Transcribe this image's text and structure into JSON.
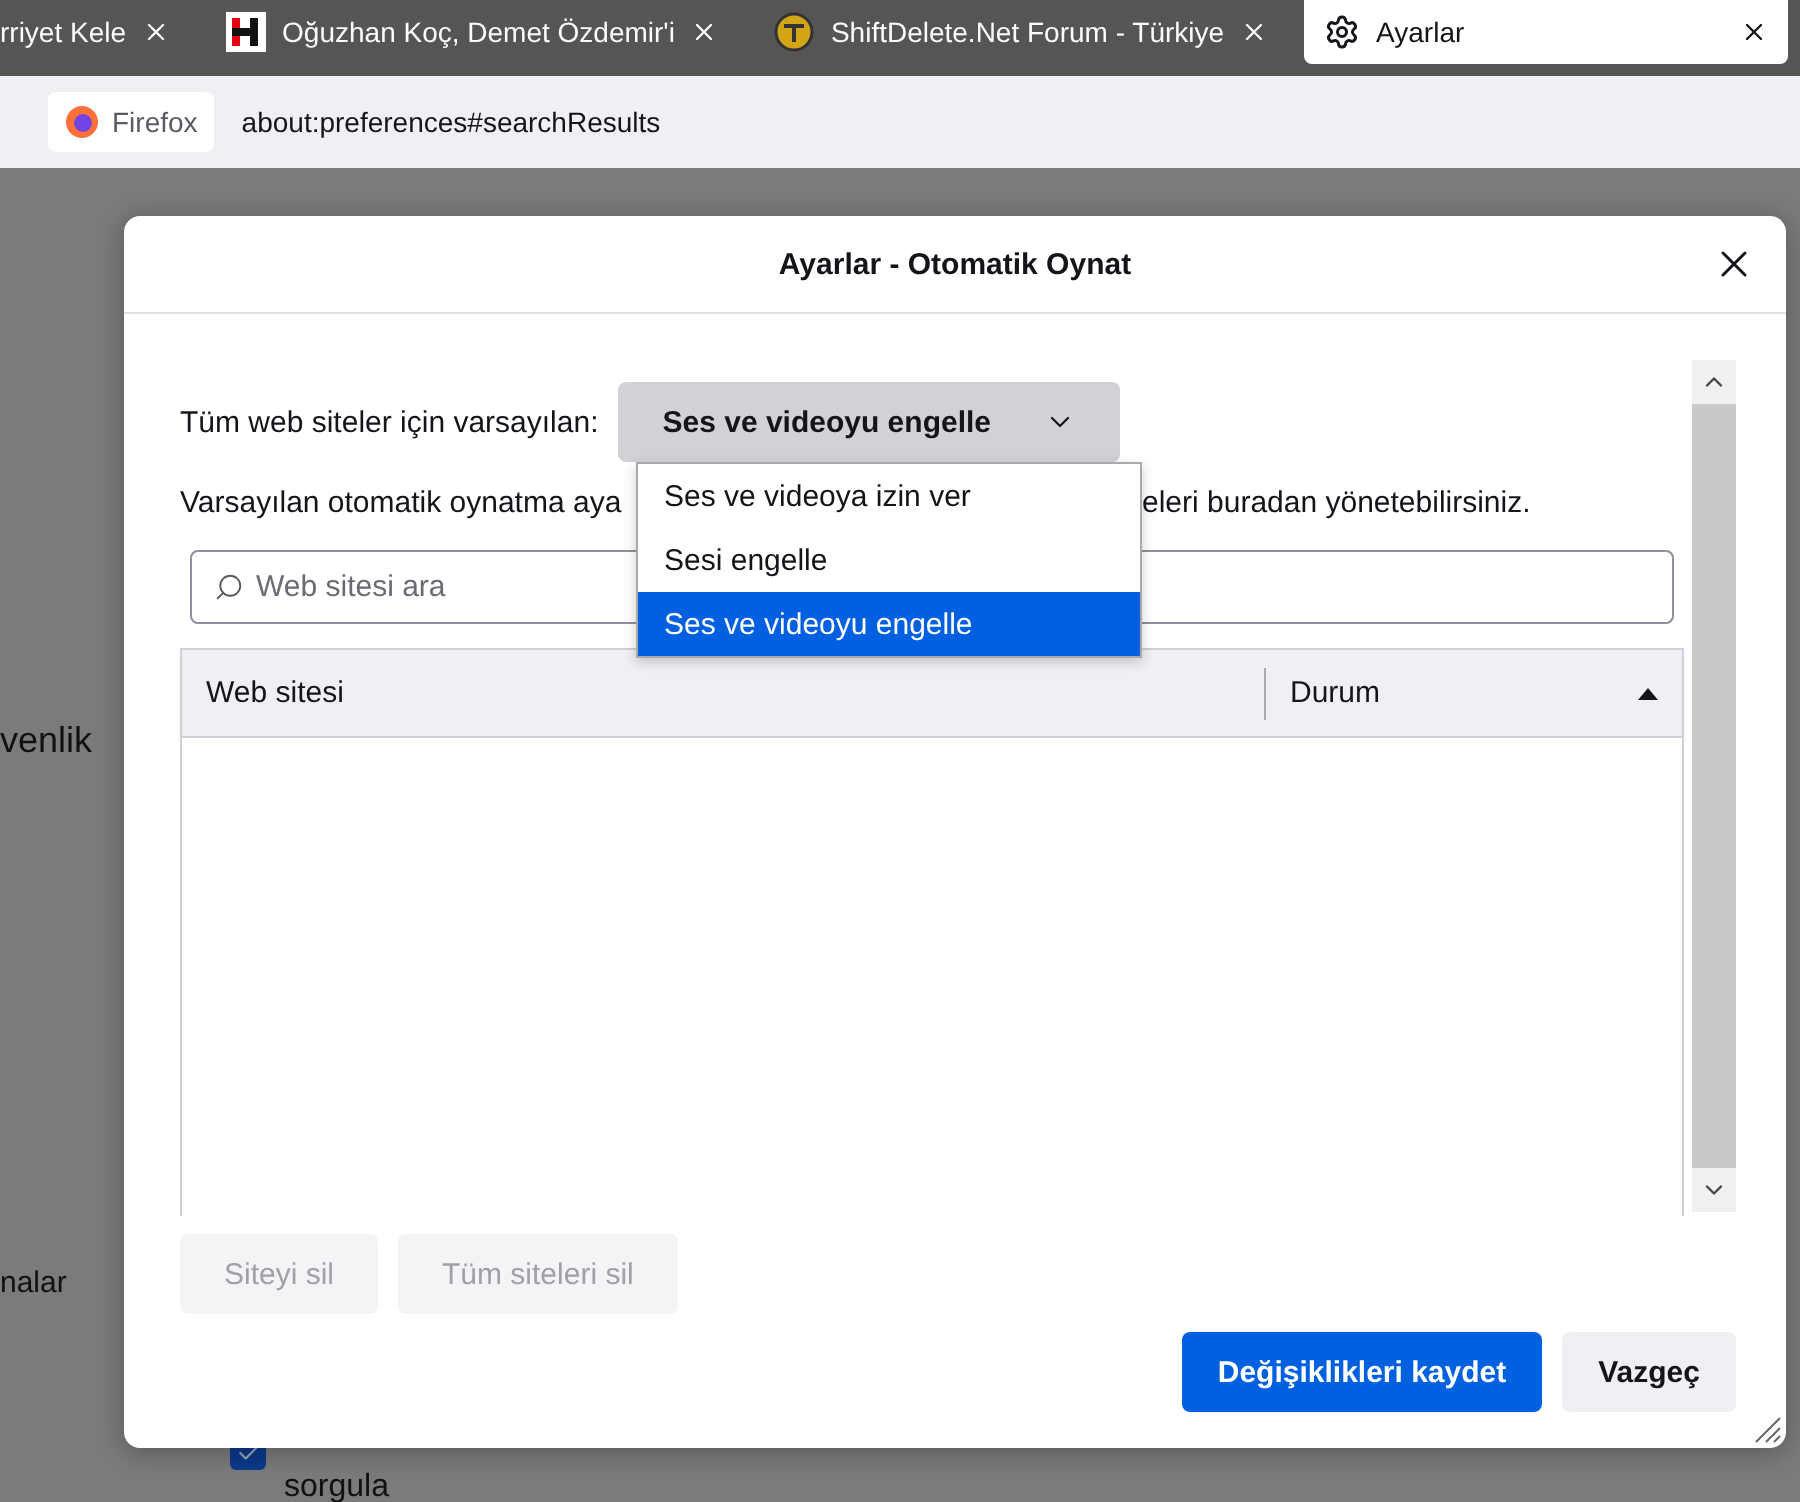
{
  "tabs": [
    {
      "label": "rriyet Kele",
      "selected": false
    },
    {
      "label": "Oğuzhan Koç, Demet Özdemir'i",
      "selected": false
    },
    {
      "label": "ShiftDelete.Net Forum - Türkiye",
      "selected": false
    },
    {
      "label": "Ayarlar",
      "selected": true
    }
  ],
  "address_bar": {
    "identity": "Firefox",
    "url": "about:preferences#searchResults"
  },
  "background": {
    "heading": "venlik",
    "item": "nalar",
    "checkbox": {
      "label": "sorgula",
      "checked": true
    }
  },
  "dialog": {
    "title": "Ayarlar - Otomatik Oynat",
    "default_label": "Tüm web siteler için varsayılan:",
    "default_select": {
      "value": "Ses ve videoyu engelle",
      "expanded": true,
      "options": [
        {
          "label": "Ses ve videoya izin ver",
          "selected": false
        },
        {
          "label": "Sesi engelle",
          "selected": false
        },
        {
          "label": "Ses ve videoyu engelle",
          "selected": true
        }
      ]
    },
    "description_start": "Varsayılan otomatik oynatma aya",
    "description_end": "eleri buradan yönetebilirsiniz.",
    "search": {
      "placeholder": "Web sitesi ara"
    },
    "table": {
      "columns": [
        {
          "label": "Web sitesi",
          "sorted": false
        },
        {
          "label": "Durum",
          "sorted": true
        }
      ]
    },
    "remove_buttons": [
      {
        "label": "Siteyi sil",
        "disabled": true
      },
      {
        "label": "Tüm siteleri sil",
        "disabled": true
      }
    ],
    "footer_buttons": [
      {
        "label": "Değişiklikleri kaydet",
        "kind": "primary"
      },
      {
        "label": "Vazgeç",
        "kind": "secondary"
      }
    ]
  }
}
